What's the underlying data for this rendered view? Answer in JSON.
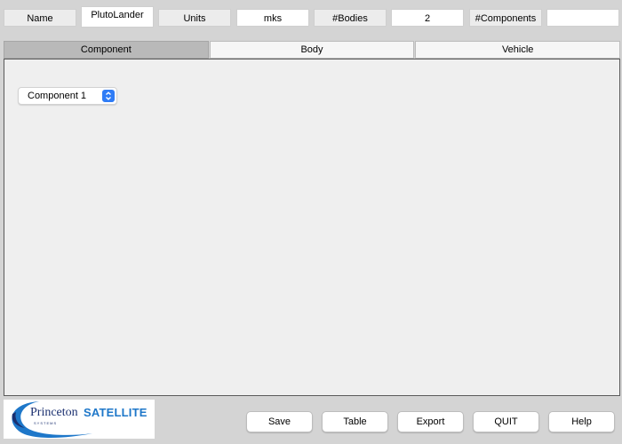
{
  "header": {
    "name_label": "Name",
    "name_value": "PlutoLander",
    "units_label": "Units",
    "units_value": "mks",
    "bodies_label": "#Bodies",
    "bodies_value": "2",
    "components_label": "#Components",
    "components_value": ""
  },
  "tabs": [
    {
      "label": "Component",
      "active": true
    },
    {
      "label": "Body",
      "active": false
    },
    {
      "label": "Vehicle",
      "active": false
    }
  ],
  "component_select": {
    "value": "Component 1"
  },
  "logo": {
    "text_princeton": "Princeton",
    "text_satellite": "SATELLITE",
    "text_systems": "SYSTEMS"
  },
  "buttons": {
    "save": "Save",
    "table": "Table",
    "export": "Export",
    "quit": "QUIT",
    "help": "Help"
  },
  "colors": {
    "select_accent": "#2f7cf6",
    "logo_blue": "#1e77c9",
    "logo_navy": "#1b3070"
  }
}
